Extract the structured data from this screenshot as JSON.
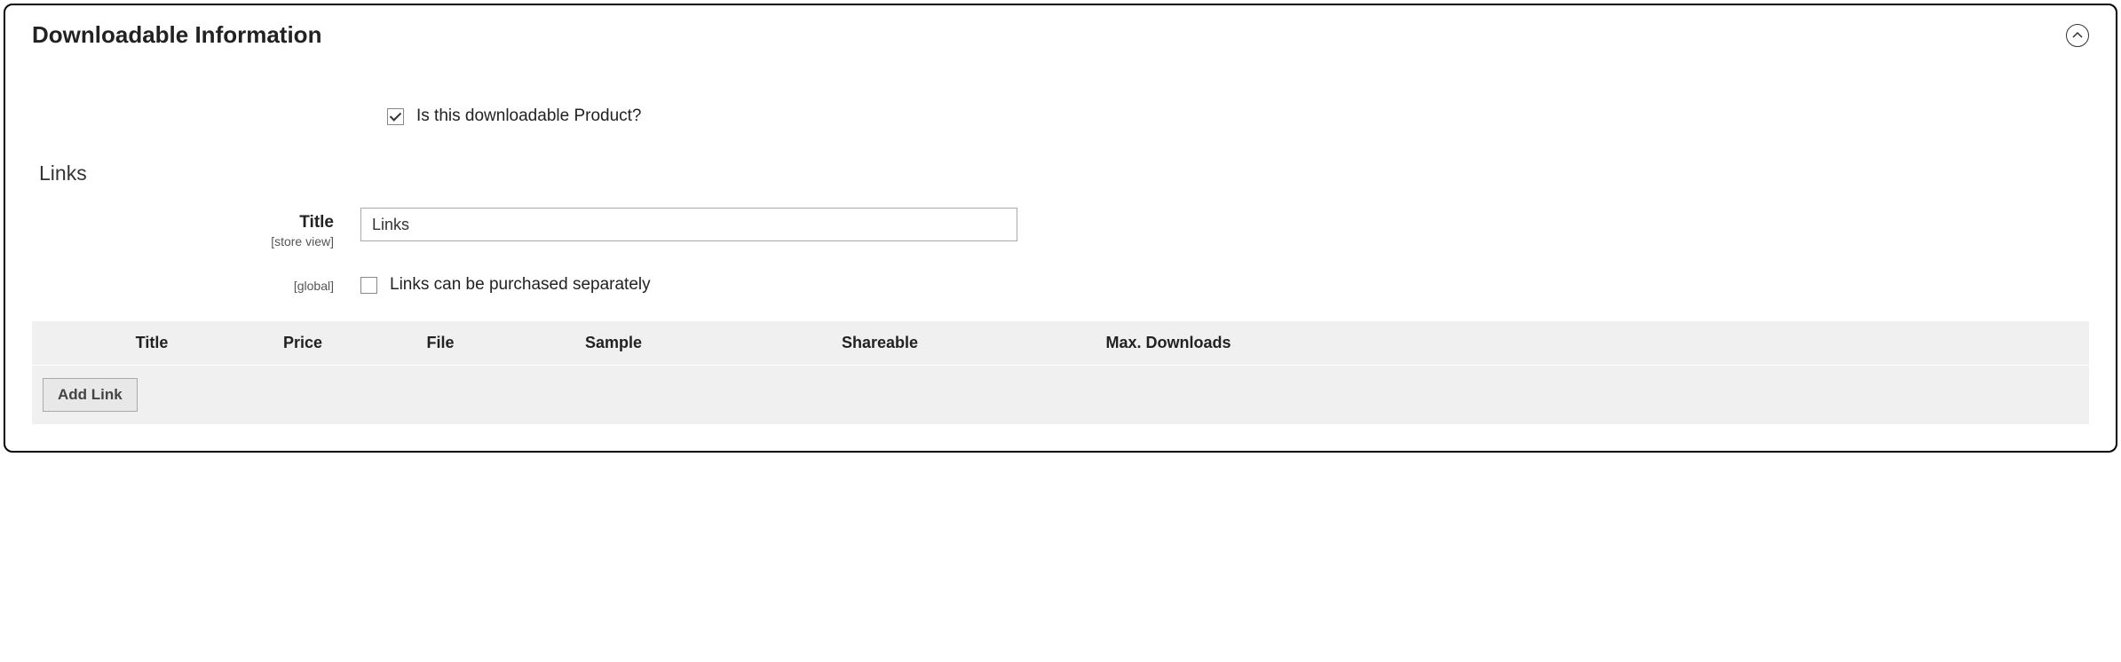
{
  "panel": {
    "title": "Downloadable Information"
  },
  "is_downloadable": {
    "label": "Is this downloadable Product?",
    "checked": true
  },
  "links_section": {
    "heading": "Links",
    "title_field": {
      "label": "Title",
      "scope": "[store view]",
      "value": "Links"
    },
    "separate_field": {
      "scope": "[global]",
      "label": "Links can be purchased separately",
      "checked": false
    },
    "table": {
      "headers": {
        "title": "Title",
        "price": "Price",
        "file": "File",
        "sample": "Sample",
        "shareable": "Shareable",
        "max_downloads": "Max. Downloads"
      },
      "add_button": "Add Link"
    }
  }
}
